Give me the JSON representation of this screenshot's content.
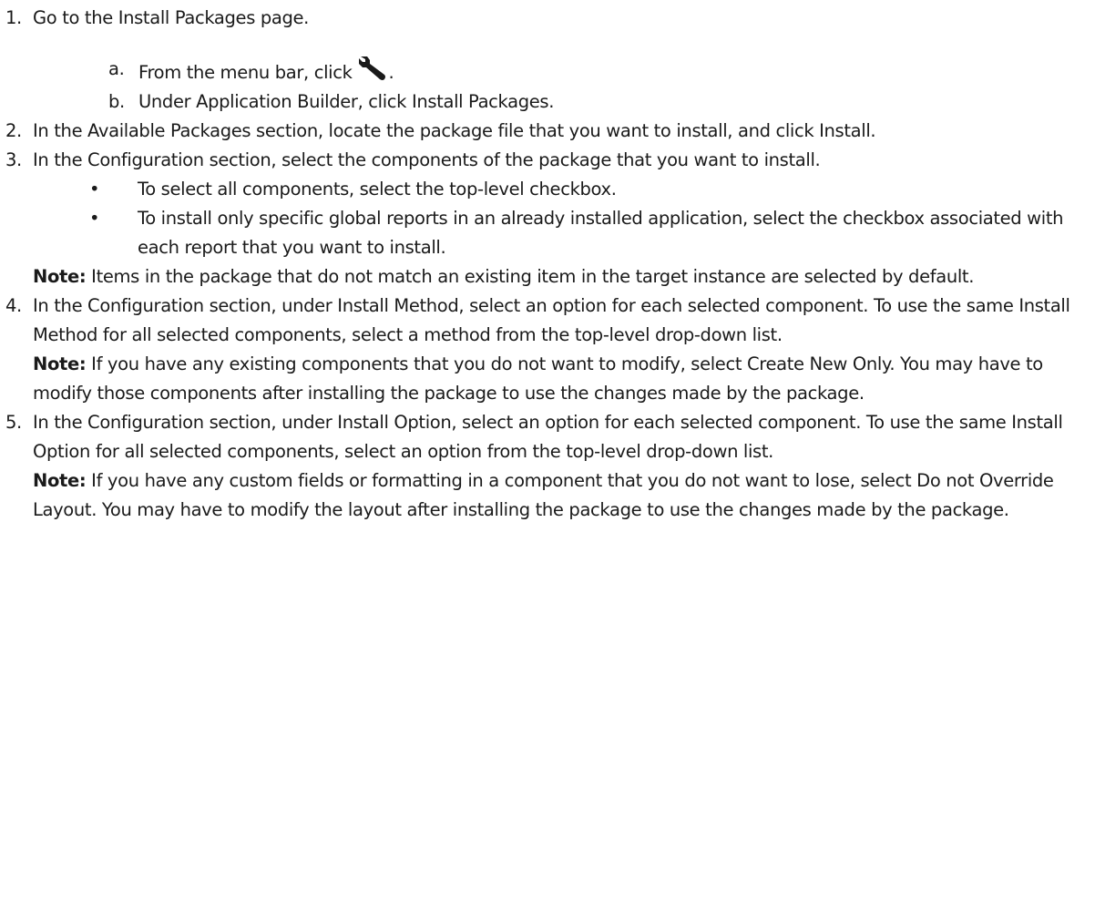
{
  "steps": [
    {
      "num": "1.",
      "text": "Go to the Install Packages page.",
      "subs": [
        {
          "letter": "a.",
          "before": "From the menu bar, click",
          "icon": "wrench-icon",
          "after": "."
        },
        {
          "letter": "b.",
          "text": "Under Application Builder, click Install Packages."
        }
      ]
    },
    {
      "num": "2.",
      "text": "In the Available Packages section, locate the package file that you want to install, and click Install."
    },
    {
      "num": "3.",
      "text": "In the Configuration section, select the components of the package that you want to install.",
      "bullets": [
        "To select all components, select the top-level checkbox.",
        "To install only specific global reports in an already installed application, select the checkbox associated with each report that you want to install."
      ],
      "note_label": "Note:",
      "note": "Items in the package that do not match an existing item in the target instance are selected by default."
    },
    {
      "num": "4.",
      "text": "In the Configuration section, under Install Method, select an option for each selected component. To use the same Install Method for all selected components, select a method from the top-level drop-down list.",
      "note_label": "Note:",
      "note": "If you have any existing components that you do not want to modify, select Create New Only. You may have to modify those components after installing the package to use the changes made by the package."
    },
    {
      "num": "5.",
      "text": "In the Configuration section, under Install Option, select an option for each selected component. To use the same Install Option for all selected components, select an option from the top-level drop-down list.",
      "note_label": "Note:",
      "note": "If you have any custom fields or formatting in a component that you do not want to lose, select Do not Override Layout. You may have to modify the layout after installing the package to use the changes made by the package."
    }
  ],
  "bullet_glyph": "•"
}
